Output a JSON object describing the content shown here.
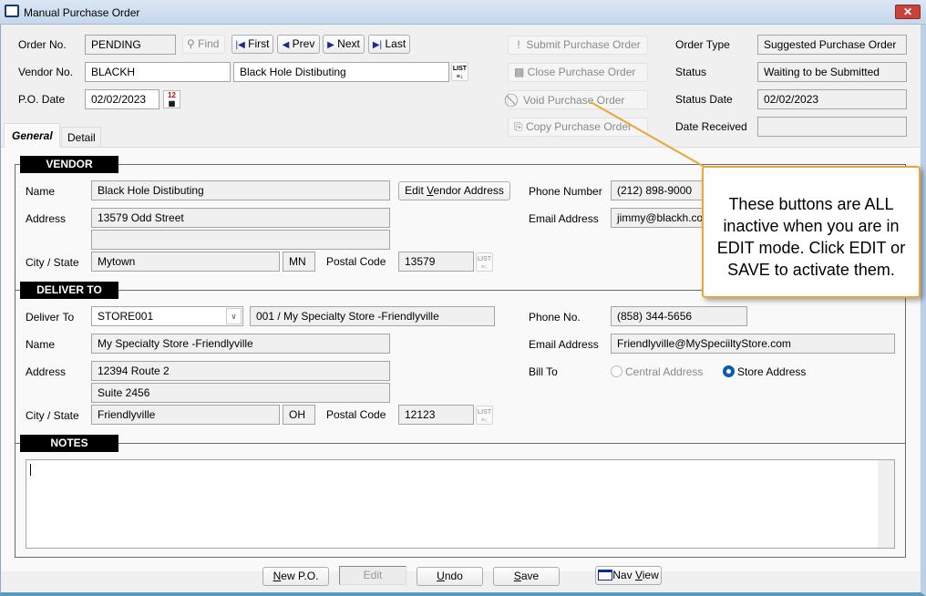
{
  "window": {
    "title": "Manual Purchase Order",
    "close": "✕"
  },
  "header": {
    "order_no_label": "Order No.",
    "order_no": "PENDING",
    "find": "Find",
    "first": "First",
    "prev": "Prev",
    "next": "Next",
    "last": "Last",
    "vendor_no_label": "Vendor No.",
    "vendor_no": "BLACKH",
    "vendor_name": "Black Hole Distibuting",
    "po_date_label": "P.O. Date",
    "po_date": "02/02/2023",
    "submit": "Submit Purchase Order",
    "close_po": "Close Purchase Order",
    "void": "Void Purchase Order",
    "copy": "Copy Purchase Order",
    "order_type_label": "Order Type",
    "order_type": "Suggested Purchase Order",
    "status_label": "Status",
    "status": "Waiting to be Submitted",
    "status_date_label": "Status Date",
    "status_date": "02/02/2023",
    "date_received_label": "Date Received",
    "date_received": ""
  },
  "tabs": [
    {
      "label": "General",
      "selected": true
    },
    {
      "label": "Detail",
      "selected": false
    }
  ],
  "vendor": {
    "heading": "VENDOR",
    "name_label": "Name",
    "name": "Black Hole Distibuting",
    "edit_address_pre": "Edit ",
    "edit_address_u": "V",
    "edit_address_post": "endor Address",
    "address_label": "Address",
    "address1": "13579 Odd Street",
    "address2": "",
    "city_label": "City / State",
    "city": "Mytown",
    "state": "MN",
    "postal_label": "Postal Code",
    "postal": "13579",
    "phone_label": "Phone Number",
    "phone": "(212) 898-9000",
    "email_label": "Email Address",
    "email": "jimmy@blackh.com"
  },
  "deliver": {
    "heading": "DELIVER TO",
    "deliver_label": "Deliver To",
    "store": "STORE001",
    "store_desc": "001 / My Specialty Store -Friendlyville",
    "name_label": "Name",
    "name": "My Specialty Store -Friendlyville",
    "address_label": "Address",
    "address1": "12394 Route 2",
    "address2": "Suite 2456",
    "city_label": "City / State",
    "city": "Friendlyville",
    "state": "OH",
    "postal_label": "Postal Code",
    "postal": "12123",
    "phone_label": "Phone No.",
    "phone": "(858) 344-5656",
    "email_label": "Email Address",
    "email": "Friendlyville@MySpeciiltyStore.com",
    "bill_to_label": "Bill To",
    "bill_central": "Central Address",
    "bill_store": "Store Address",
    "bill_to_selected": "Store Address"
  },
  "notes": {
    "heading": "NOTES",
    "value": ""
  },
  "footer": {
    "new_u": "N",
    "new_rest": "ew P.O.",
    "edit": "Edit",
    "undo_u": "U",
    "undo_rest": "ndo",
    "save_u": "S",
    "save_rest": "ave",
    "nav_pre": "Nav ",
    "nav_u": "V",
    "nav_rest": "iew"
  },
  "callout": {
    "text": "These buttons are ALL inactive when you are in EDIT mode. Click EDIT or SAVE to activate them."
  },
  "colors": {
    "callout_border": "#e8a838",
    "group_header": "#000000",
    "radio_selected": "#0a5ba8"
  }
}
